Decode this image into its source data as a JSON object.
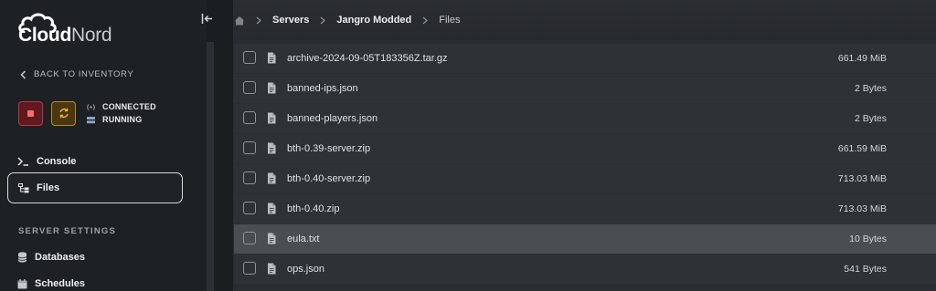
{
  "brand": {
    "name_part1": "Cloud",
    "name_part2": "Nord"
  },
  "sidebar": {
    "back_label": "BACK TO INVENTORY",
    "status": {
      "connection": "CONNECTED",
      "state": "RUNNING"
    },
    "nav": [
      {
        "label": "Console",
        "icon": "terminal-icon"
      },
      {
        "label": "Files",
        "icon": "folder-tree-icon",
        "active": true
      }
    ],
    "section_title": "SERVER SETTINGS",
    "settings": [
      {
        "label": "Databases",
        "icon": "database-icon"
      },
      {
        "label": "Schedules",
        "icon": "calendar-icon"
      }
    ]
  },
  "breadcrumb": {
    "items": [
      "Servers",
      "Jangro Modded"
    ],
    "current": "Files"
  },
  "files": [
    {
      "name": "archive-2024-09-05T183356Z.tar.gz",
      "size": "661.49 MiB"
    },
    {
      "name": "banned-ips.json",
      "size": "2 Bytes"
    },
    {
      "name": "banned-players.json",
      "size": "2 Bytes"
    },
    {
      "name": "bth-0.39-server.zip",
      "size": "661.59 MiB"
    },
    {
      "name": "bth-0.40-server.zip",
      "size": "713.03 MiB"
    },
    {
      "name": "bth-0.40.zip",
      "size": "713.03 MiB"
    },
    {
      "name": "eula.txt",
      "size": "10 Bytes",
      "highlighted": true
    },
    {
      "name": "ops.json",
      "size": "541 Bytes"
    }
  ],
  "colors": {
    "sidebar_bg": "#1e2124",
    "content_bg": "#2a2d31",
    "row_bg": "#2e3236",
    "row_highlight": "#4a4d52",
    "stop_accent": "#ff6b70",
    "restart_accent": "#f0b534"
  }
}
